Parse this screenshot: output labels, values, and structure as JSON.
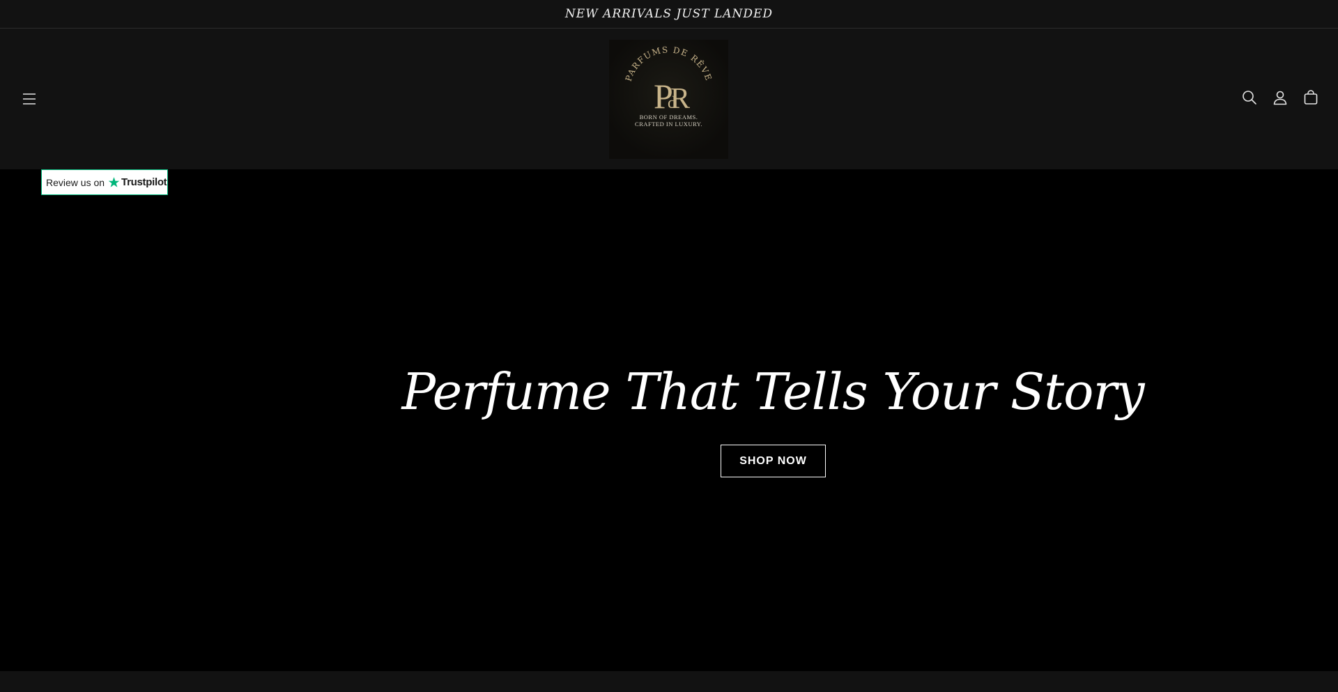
{
  "announcement": {
    "text": "NEW ARRIVALS JUST LANDED"
  },
  "header": {
    "menu_icon": "hamburger-menu-icon",
    "logo": {
      "arc_text": "PARFUMS DE RÊVE",
      "monogram_main": "P",
      "monogram_small": "d",
      "monogram_second": "R",
      "tagline_line1": "BORN OF DREAMS.",
      "tagline_line2": "CRAFTED IN LUXURY.",
      "gold_color": "#c8b48a"
    },
    "icons": [
      "search-icon",
      "account-icon",
      "cart-icon"
    ]
  },
  "trustpilot": {
    "review_text": "Review us on",
    "brand": "Trustpilot",
    "star_color": "#00b67a"
  },
  "hero": {
    "title": "Perfume That Tells Your Story",
    "button_label": "SHOP NOW"
  },
  "colors": {
    "header_bg": "#121212",
    "hero_bg": "#000000",
    "text": "#ffffff"
  }
}
